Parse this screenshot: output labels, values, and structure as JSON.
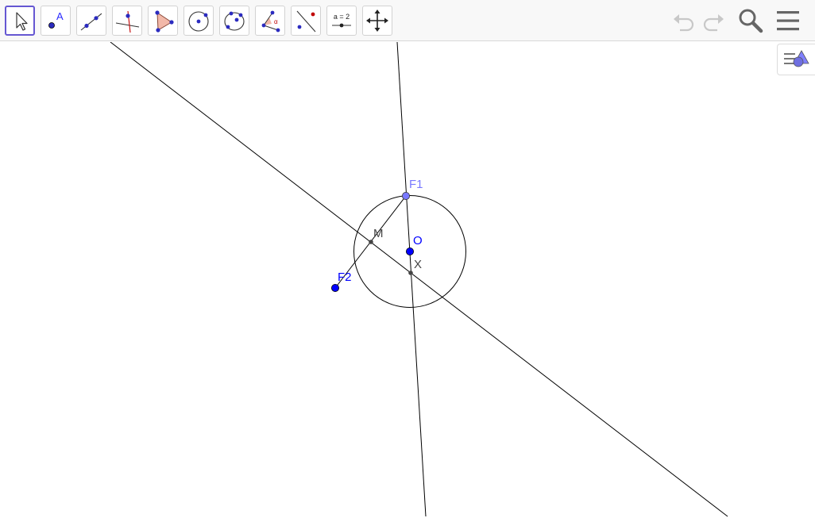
{
  "toolbar": {
    "tools": [
      {
        "icon": "move-arrow-icon",
        "selected": true
      },
      {
        "icon": "point-icon",
        "text": "A"
      },
      {
        "icon": "line-icon"
      },
      {
        "icon": "perpendicular-line-icon"
      },
      {
        "icon": "polygon-icon"
      },
      {
        "icon": "circle-center-point-icon"
      },
      {
        "icon": "conic-five-points-icon"
      },
      {
        "icon": "angle-icon",
        "text": "α"
      },
      {
        "icon": "reflect-point-icon"
      },
      {
        "icon": "slider-icon",
        "text": "a = 2"
      },
      {
        "icon": "move-view-icon"
      }
    ],
    "right_buttons": [
      "undo-icon",
      "redo-icon",
      "search-icon",
      "menu-icon"
    ]
  },
  "style_bar_toggle": {
    "icon": "style-bar-icon"
  },
  "construction": {
    "points": {
      "F1": {
        "label": "F1",
        "color": "#7878ff"
      },
      "F2": {
        "label": "F2",
        "color": "#0000ff"
      },
      "O": {
        "label": "O",
        "color": "#0000ff"
      },
      "M": {
        "label": "M",
        "color": "#444444"
      },
      "X": {
        "label": "X",
        "color": "#444444"
      }
    }
  },
  "colors": {
    "accent": "#6557d2",
    "free_point": "#0000ff",
    "dependent_point": "#444444",
    "line": "#000000",
    "toolbar_bg": "#f8f8f8"
  }
}
